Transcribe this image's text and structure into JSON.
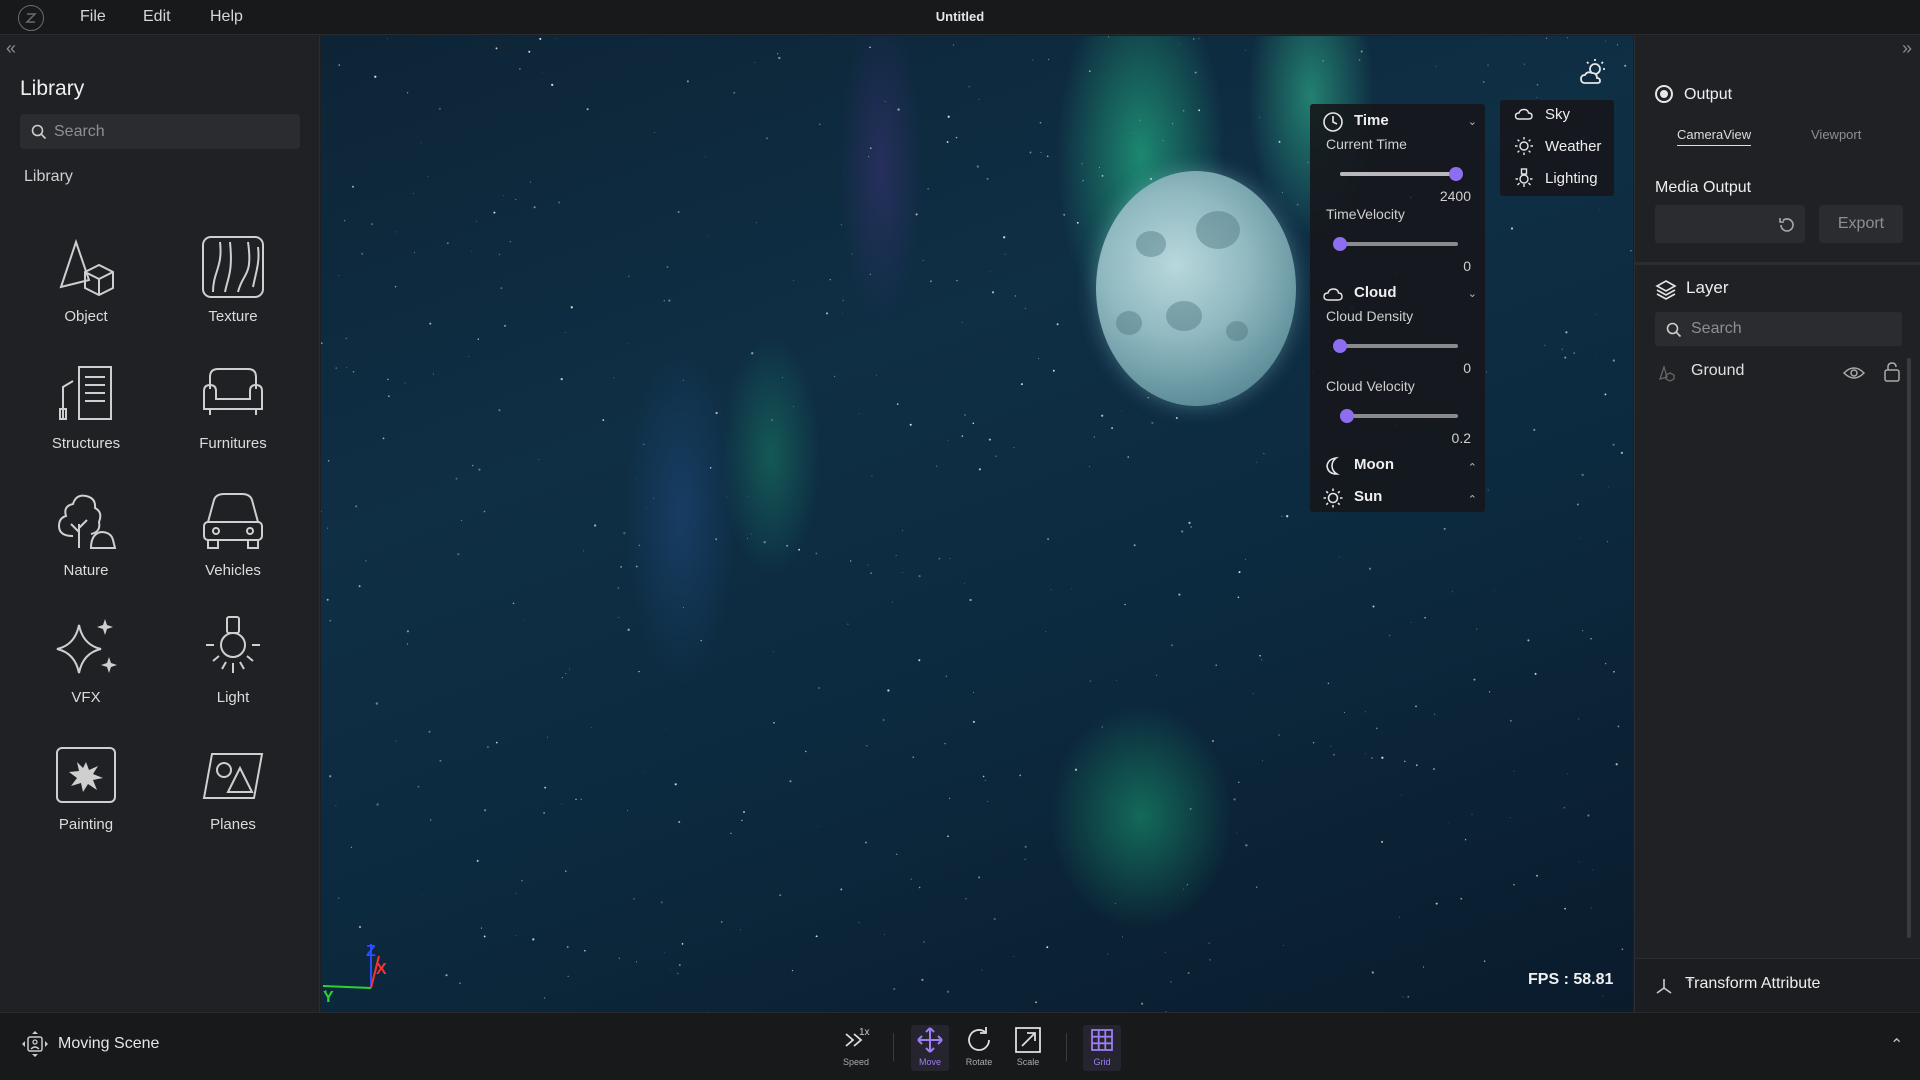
{
  "topbar": {
    "menu": [
      "File",
      "Edit",
      "Help"
    ],
    "title": "Untitled"
  },
  "library": {
    "title": "Library",
    "search_placeholder": "Search",
    "section_label": "Library",
    "items": [
      "Object",
      "Texture",
      "Structures",
      "Furnitures",
      "Nature",
      "Vehicles",
      "VFX",
      "Light",
      "Painting",
      "Planes"
    ]
  },
  "time_panel": {
    "time_label": "Time",
    "current_time_label": "Current Time",
    "current_time_value": "2400",
    "current_time_fraction": 0.98,
    "time_velocity_label": "TimeVelocity",
    "time_velocity_value": "0",
    "time_velocity_fraction": 0.0,
    "cloud_label": "Cloud",
    "cloud_density_label": "Cloud Density",
    "cloud_density_value": "0",
    "cloud_density_fraction": 0.0,
    "cloud_velocity_label": "Cloud Velocity",
    "cloud_velocity_value": "0.2",
    "cloud_velocity_fraction": 0.06,
    "moon_label": "Moon",
    "sun_label": "Sun"
  },
  "sky_panel": {
    "items": [
      "Sky",
      "Weather",
      "Lighting"
    ]
  },
  "viewport": {
    "fps": "FPS : 58.81",
    "axis_labels": {
      "x": "X",
      "y": "Y",
      "z": "Z"
    }
  },
  "output": {
    "title": "Output",
    "tabs": [
      "CameraView",
      "Viewport"
    ],
    "media_output_label": "Media Output",
    "export_label": "Export"
  },
  "layer": {
    "title": "Layer",
    "search_placeholder": "Search",
    "rows": [
      "Ground"
    ]
  },
  "transform": {
    "title": "Transform Attribute"
  },
  "bottombar": {
    "moving_scene": "Moving Scene",
    "speed_value": "1x",
    "tools": [
      "Speed",
      "Move",
      "Rotate",
      "Scale",
      "Grid"
    ]
  },
  "colors": {
    "accent": "#8d6ef0",
    "panel_bg": "#202124",
    "topbar_bg": "#18191b"
  }
}
